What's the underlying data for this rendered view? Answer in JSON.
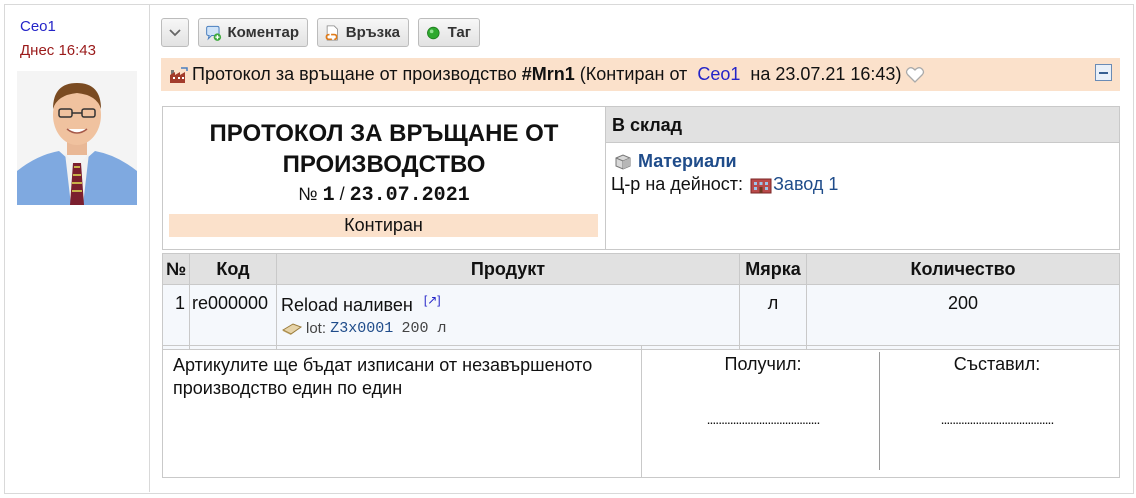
{
  "sidebar": {
    "author": "Ceo1",
    "date": "Днес 16:43"
  },
  "toolbar": {
    "comment_label": "Коментар",
    "link_label": "Връзка",
    "tag_label": "Таг"
  },
  "titlebar": {
    "prefix": "Протокол за връщане от производство",
    "number": "#Mrn1",
    "status_prefix": "(Контиран от",
    "user": "Ceo1",
    "date_text": "на 23.07.21 16:43)"
  },
  "document": {
    "title_line1": "ПРОТОКОЛ ЗА ВРЪЩАНЕ ОТ",
    "title_line2": "ПРОИЗВОДСТВО",
    "num_sign": "№",
    "number": "1",
    "slash": "/",
    "date": "23.07.2021",
    "status": "Контиран",
    "store_header": "В склад",
    "store_name": "Материали",
    "activity_label": "Ц-р на дейност:",
    "activity_value": "Завод 1"
  },
  "table": {
    "headers": [
      "№",
      "Код",
      "Продукт",
      "Мярка",
      "Количество"
    ],
    "rows": [
      {
        "no": "1",
        "code": "re000000",
        "product": "Reload наливен",
        "ext_link": "[↗]",
        "lot_label": "lot:",
        "lot_code": "Z3x0001",
        "lot_qty": "200 л",
        "unit": "л",
        "qty": "200"
      }
    ]
  },
  "footer": {
    "note": "Артикулите ще бъдат изписани от незавършеното производство един по един",
    "received_label": "Получил:",
    "compiled_label": "Съставил:",
    "dots": "......................................."
  },
  "colors": {
    "accent_bg": "#fbe1cb",
    "link": "#2424c8",
    "header_bg": "#e1e1e1"
  }
}
